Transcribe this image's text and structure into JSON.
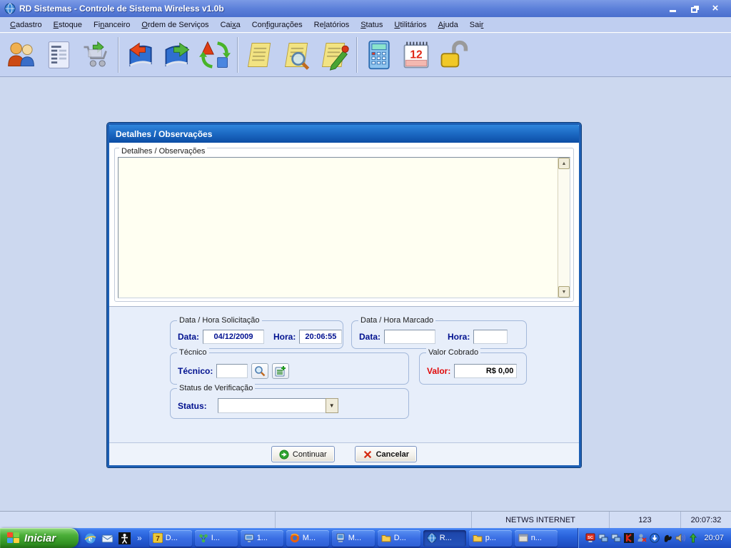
{
  "window": {
    "title": "RD Sistemas - Controle de Sistema Wireless v1.0b"
  },
  "menu": {
    "items": [
      {
        "id": "cadastro",
        "label": "Cadastro",
        "accel": 0
      },
      {
        "id": "estoque",
        "label": "Estoque",
        "accel": 0
      },
      {
        "id": "financeiro",
        "label": "Financeiro",
        "accel": 2
      },
      {
        "id": "ordem-de-servicos",
        "label": "Ordem de Serviços",
        "accel": 0
      },
      {
        "id": "caixa",
        "label": "Caixa",
        "accel": 3
      },
      {
        "id": "configuracoes",
        "label": "Configurações",
        "accel": 3
      },
      {
        "id": "relatorios",
        "label": "Relatórios",
        "accel": 2
      },
      {
        "id": "status",
        "label": "Status",
        "accel": 0
      },
      {
        "id": "utilitarios",
        "label": "Utilitários",
        "accel": 0
      },
      {
        "id": "ajuda",
        "label": "Ajuda",
        "accel": 0
      },
      {
        "id": "sair",
        "label": "Sair",
        "accel": 3
      }
    ]
  },
  "toolbar": {
    "icons": [
      "users-icon",
      "document-icon",
      "cart-icon",
      "book-previous-icon",
      "book-next-icon",
      "sync-icon",
      "note-icon",
      "note-search-icon",
      "note-edit-icon",
      "calculator-icon",
      "calendar-icon",
      "unlock-icon"
    ]
  },
  "dialog": {
    "title": "Detalhes / Observações",
    "details_group_label": "Detalhes / Observações",
    "details_text": "",
    "solicitacao": {
      "caption": "Data / Hora  Solicitação",
      "data_label": "Data:",
      "data_value": "04/12/2009",
      "hora_label": "Hora:",
      "hora_value": "20:06:55"
    },
    "marcado": {
      "caption": "Data / Hora Marcado",
      "data_label": "Data:",
      "data_value": "",
      "hora_label": "Hora:",
      "hora_value": ""
    },
    "tecnico": {
      "caption": "Técnico",
      "label": "Técnico:",
      "value": ""
    },
    "valor": {
      "caption": "Valor Cobrado",
      "label": "Valor:",
      "value": "R$ 0,00"
    },
    "status": {
      "caption": "Status de Verificação",
      "label": "Status:",
      "value": ""
    },
    "buttons": {
      "continue_label": "Continuar",
      "cancel_label": "Cancelar"
    }
  },
  "statusbar": {
    "panels": [
      "",
      "",
      "NETWS INTERNET",
      "123",
      "20:07:32"
    ]
  },
  "taskbar": {
    "start_label": "Iniciar",
    "overflow_chevron": "»",
    "quick_launch": [
      "ie-icon",
      "mail-icon",
      "accessibility-icon"
    ],
    "tasks": [
      {
        "icon": "delphi-icon",
        "label": "D...",
        "active": false
      },
      {
        "icon": "network-icon",
        "label": "I...",
        "active": false
      },
      {
        "icon": "monitor-icon",
        "label": "1...",
        "active": false
      },
      {
        "icon": "firefox-icon",
        "label": "M...",
        "active": false
      },
      {
        "icon": "computer-icon",
        "label": "M...",
        "active": false
      },
      {
        "icon": "folder-icon",
        "label": "D...",
        "active": false
      },
      {
        "icon": "rd-app-icon",
        "label": "R...",
        "active": true
      },
      {
        "icon": "folder-icon",
        "label": "p...",
        "active": false
      },
      {
        "icon": "window-icon",
        "label": "n...",
        "active": false
      }
    ],
    "tray_icons": [
      "sc-monitor-icon",
      "lan-icon",
      "lan-icon",
      "kaspersky-icon",
      "offline-user-icon",
      "update-icon",
      "ink-icon",
      "volume-icon",
      "upload-icon"
    ],
    "clock": "20:07"
  }
}
